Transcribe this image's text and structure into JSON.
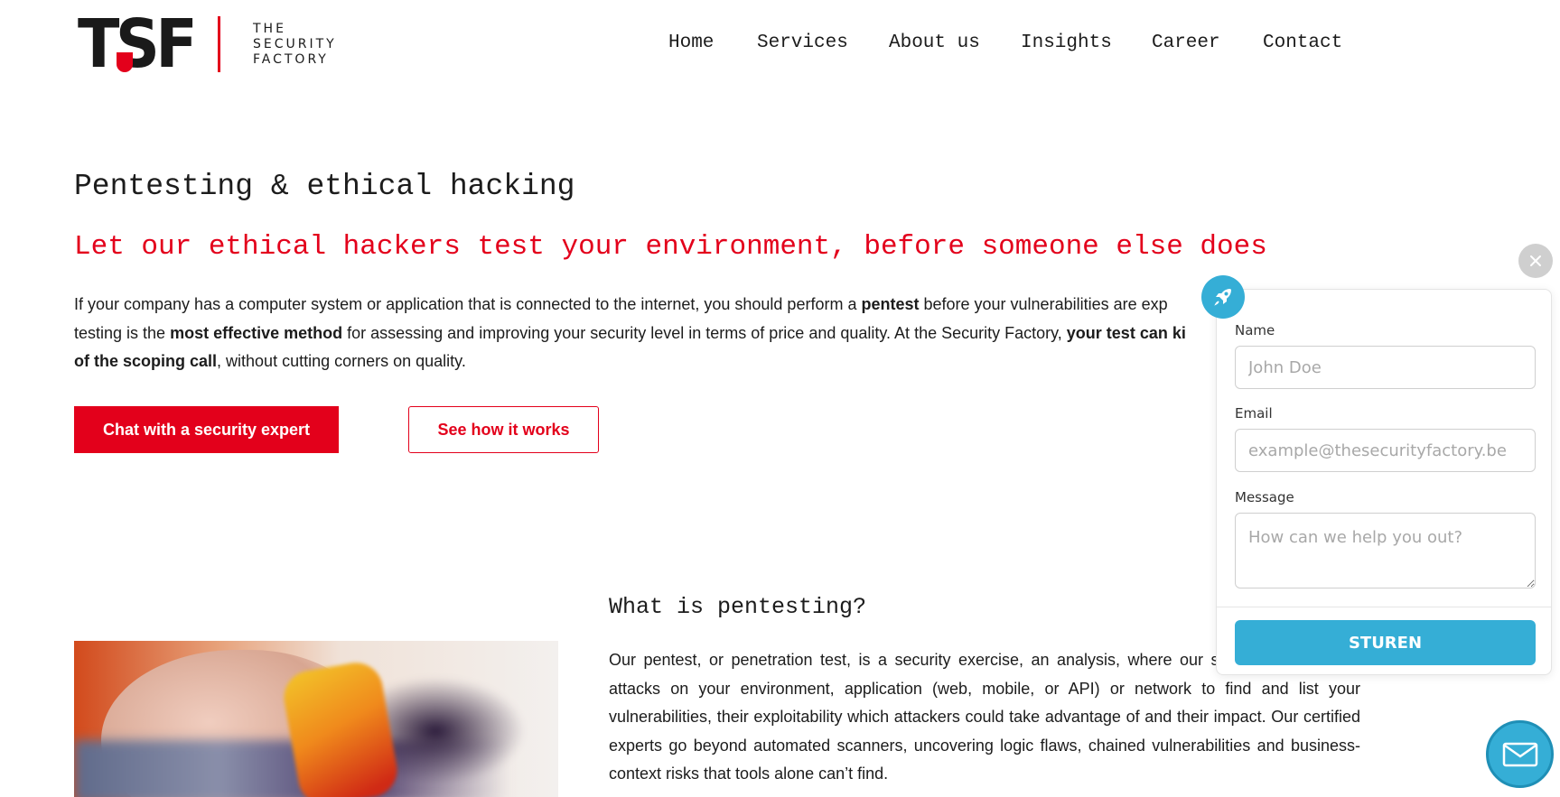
{
  "brand": {
    "logo_mark": "TSF",
    "logo_text": [
      "THE",
      "SECURITY",
      "FACTORY"
    ]
  },
  "nav": [
    {
      "label": "Home"
    },
    {
      "label": "Services"
    },
    {
      "label": "About us"
    },
    {
      "label": "Insights"
    },
    {
      "label": "Career"
    },
    {
      "label": "Contact"
    }
  ],
  "hero": {
    "title": "Pentesting & ethical hacking",
    "subtitle": "Let our ethical hackers test your environment, before someone else does",
    "intro": {
      "p1": "If your company has a computer system or application that is connected to the internet, you should perform a ",
      "b1": "pentest",
      "p2": " before your vulnerabilities are exp",
      "p3": "testing is the ",
      "b2": "most effective method",
      "p4": " for assessing and improving your security level in terms of price and quality. At the Security Factory, ",
      "b3": "your test can ki",
      "b4": "of the scoping call",
      "p5": ", without cutting corners on quality."
    },
    "primary_button": "Chat with a security expert",
    "secondary_button": "See how it works"
  },
  "section2": {
    "title": "What is pentesting?",
    "body": "Our pentest, or penetration test, is a security exercise, an analysis, where our simulate a series of attacks on your environment, application (web, mobile, or API) or network to find and list your vulnerabilities, their exploitability which attackers could take advantage of and their impact. Our certified experts go beyond automated scanners, uncovering logic flaws, chained vulnerabilities and business-context risks that tools alone can’t find."
  },
  "widget": {
    "name_label": "Name",
    "name_placeholder": "John Doe",
    "email_label": "Email",
    "email_placeholder": "example@thesecurityfactory.be",
    "message_label": "Message",
    "message_placeholder": "How can we help you out?",
    "submit_label": "STUREN"
  },
  "colors": {
    "brand_red": "#e3001b",
    "widget_blue": "#35aed6"
  },
  "icons": {
    "close": "close-icon",
    "rocket": "rocket-icon",
    "chat": "envelope-icon"
  }
}
